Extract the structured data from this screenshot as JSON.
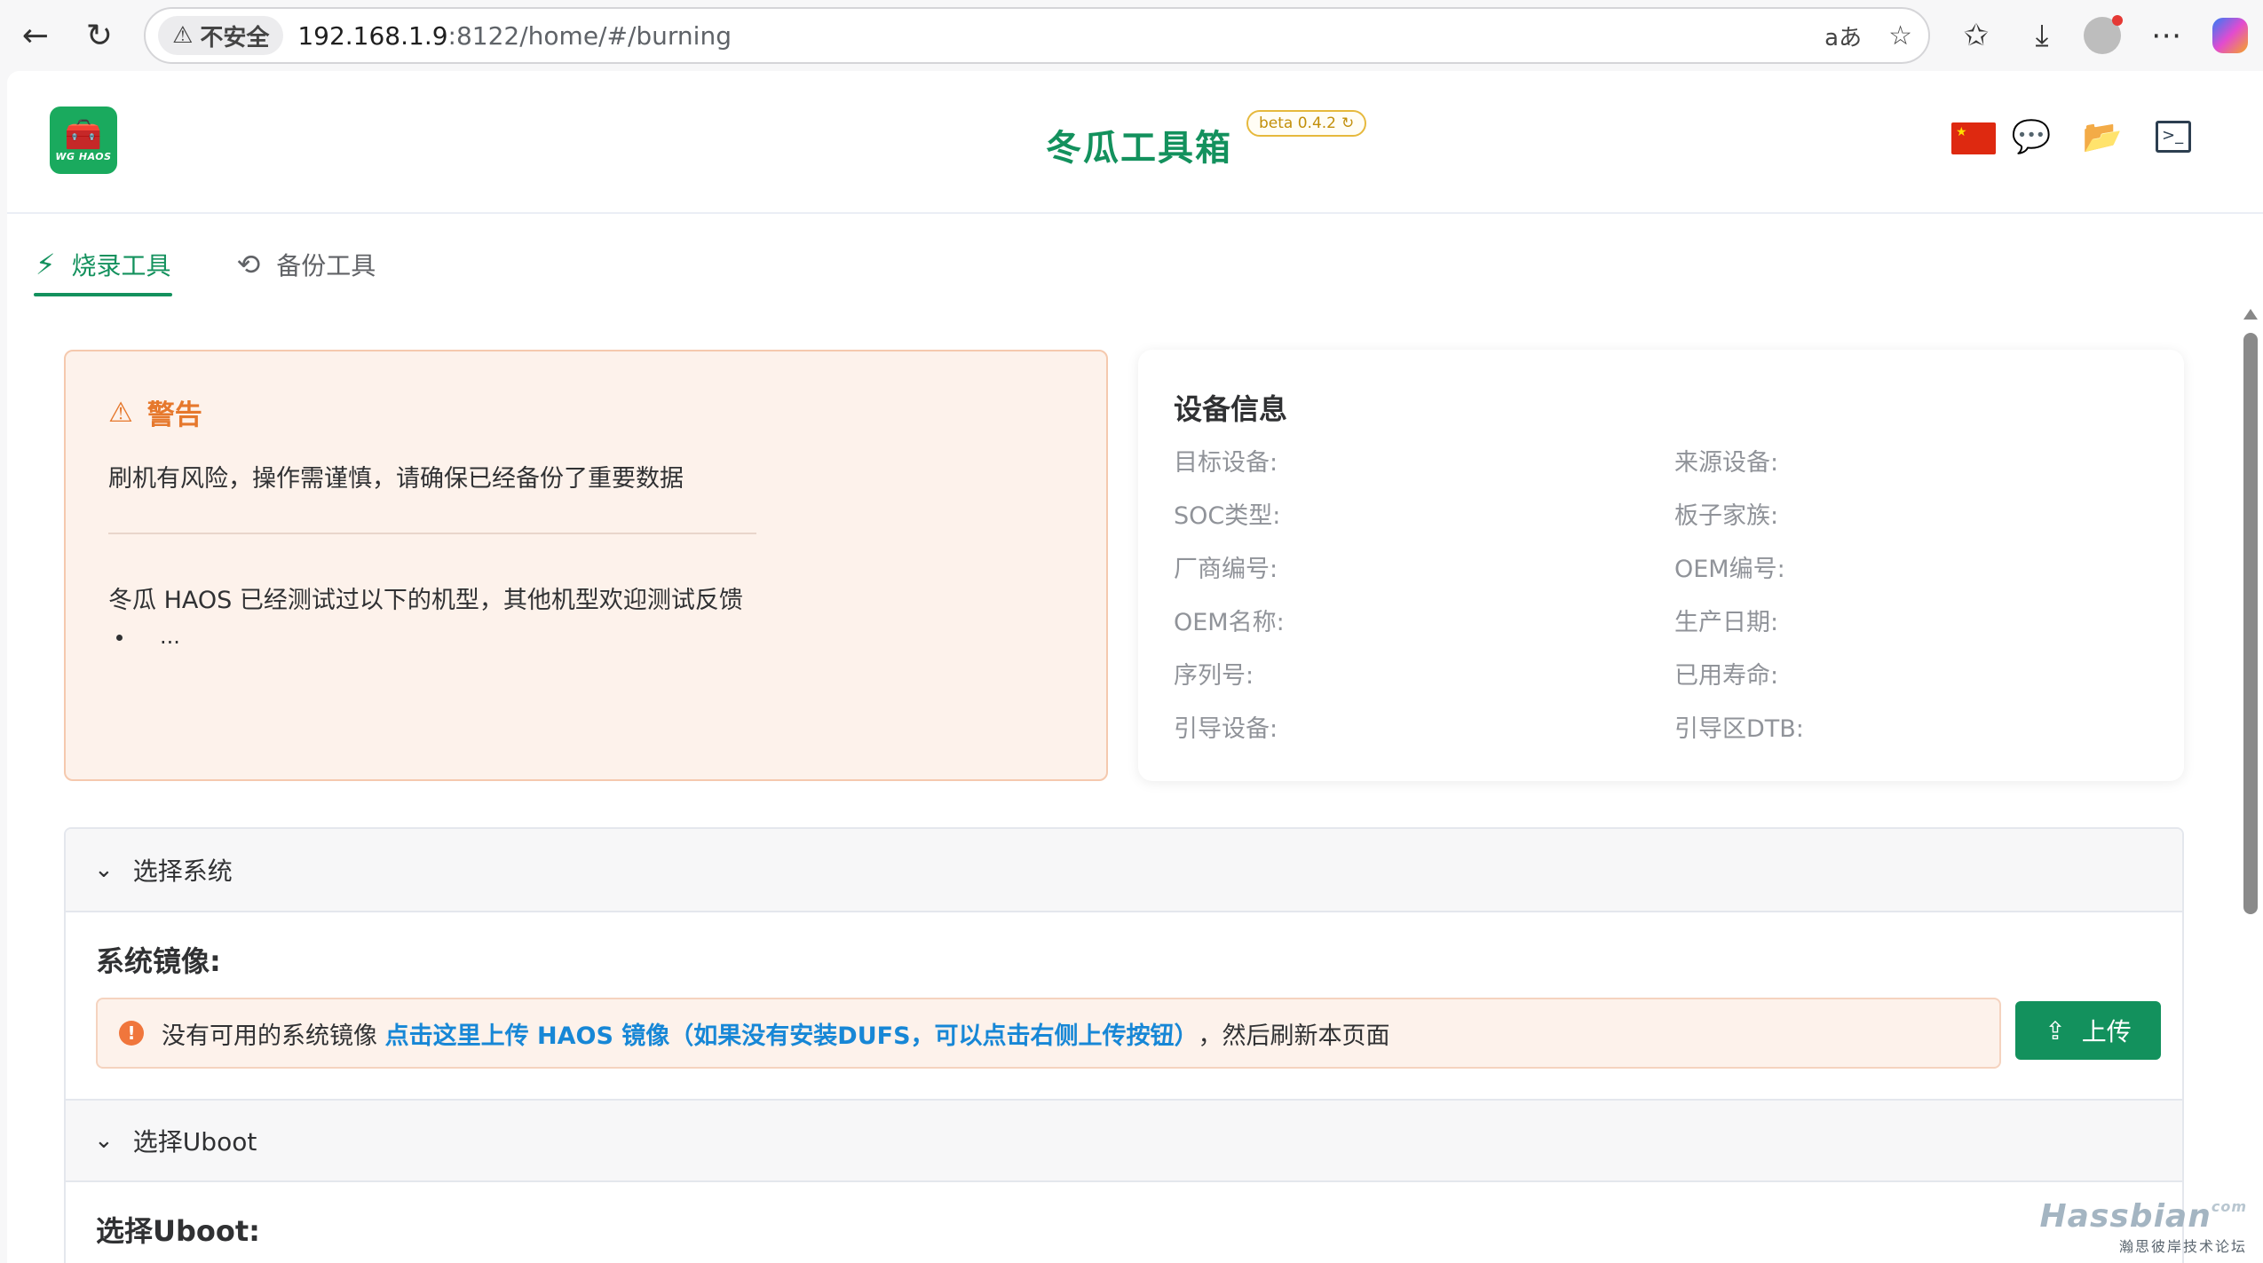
{
  "browser": {
    "insecure_label": "不安全",
    "url_host": "192.168.1.9",
    "url_path": ":8122/home/#/burning",
    "read_aloud_glyph": "aあ"
  },
  "header": {
    "logo_text": "WG HAOS",
    "title": "冬瓜工具箱",
    "version_badge": "beta 0.4.2",
    "brand_color": "#13915d",
    "icons": [
      "china-flag-icon",
      "chat-icon",
      "folder-icon",
      "terminal-icon"
    ]
  },
  "tabs": [
    {
      "label": "烧录工具",
      "icon": "lightning-icon",
      "active": true
    },
    {
      "label": "备份工具",
      "icon": "history-icon",
      "active": false
    }
  ],
  "warning": {
    "title": "警告",
    "text": "刷机有风险，操作需谨慎，请确保已经备份了重要数据",
    "tested_text": "冬瓜 HAOS 已经测试过以下的机型，其他机型欢迎测试反馈",
    "tested_items": [
      "..."
    ]
  },
  "device_info": {
    "title": "设备信息",
    "fields": [
      "目标设备:",
      "来源设备:",
      "SOC类型:",
      "板子家族:",
      "厂商编号:",
      "OEM编号:",
      "OEM名称:",
      "生产日期:",
      "序列号:",
      "已用寿命:",
      "引导设备:",
      "引导区DTB:"
    ]
  },
  "system_panel": {
    "header": "选择系统",
    "section_title": "系统镜像:",
    "alert_prefix": "没有可用的系统镜像 ",
    "alert_link": "点击这里上传 HAOS 镜像（如果没有安装DUFS，可以点击右侧上传按钮）",
    "alert_suffix": "，然后刷新本页面",
    "upload_label": "上传"
  },
  "uboot_panel": {
    "header": "选择Uboot",
    "section_title": "选择Uboot:"
  },
  "watermark": {
    "brand": "Hassbian",
    "brand_suffix": "com",
    "sub": "瀚思彼岸技术论坛"
  }
}
